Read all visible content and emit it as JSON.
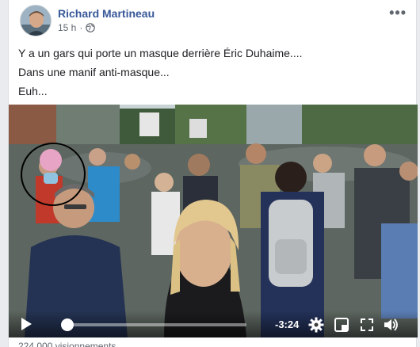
{
  "post": {
    "author": "Richard Martineau",
    "timestamp": "15 h",
    "privacy_icon": "globe-icon",
    "more_icon": "more-options-icon",
    "more_label": "•••",
    "lines": [
      "Y a un gars qui porte un masque derrière Éric Duhaime....",
      "Dans une manif anti-masque...",
      "Euh..."
    ]
  },
  "video": {
    "time_remaining": "-3:24",
    "progress": 0.0,
    "icons": [
      "play-icon",
      "settings-icon",
      "picture-in-picture-icon",
      "fullscreen-icon",
      "volume-icon"
    ]
  },
  "footer": {
    "views": "224 000 visionnements"
  },
  "colors": {
    "author": "#385898",
    "meta": "#606770",
    "annotation_circle": "#000000"
  }
}
